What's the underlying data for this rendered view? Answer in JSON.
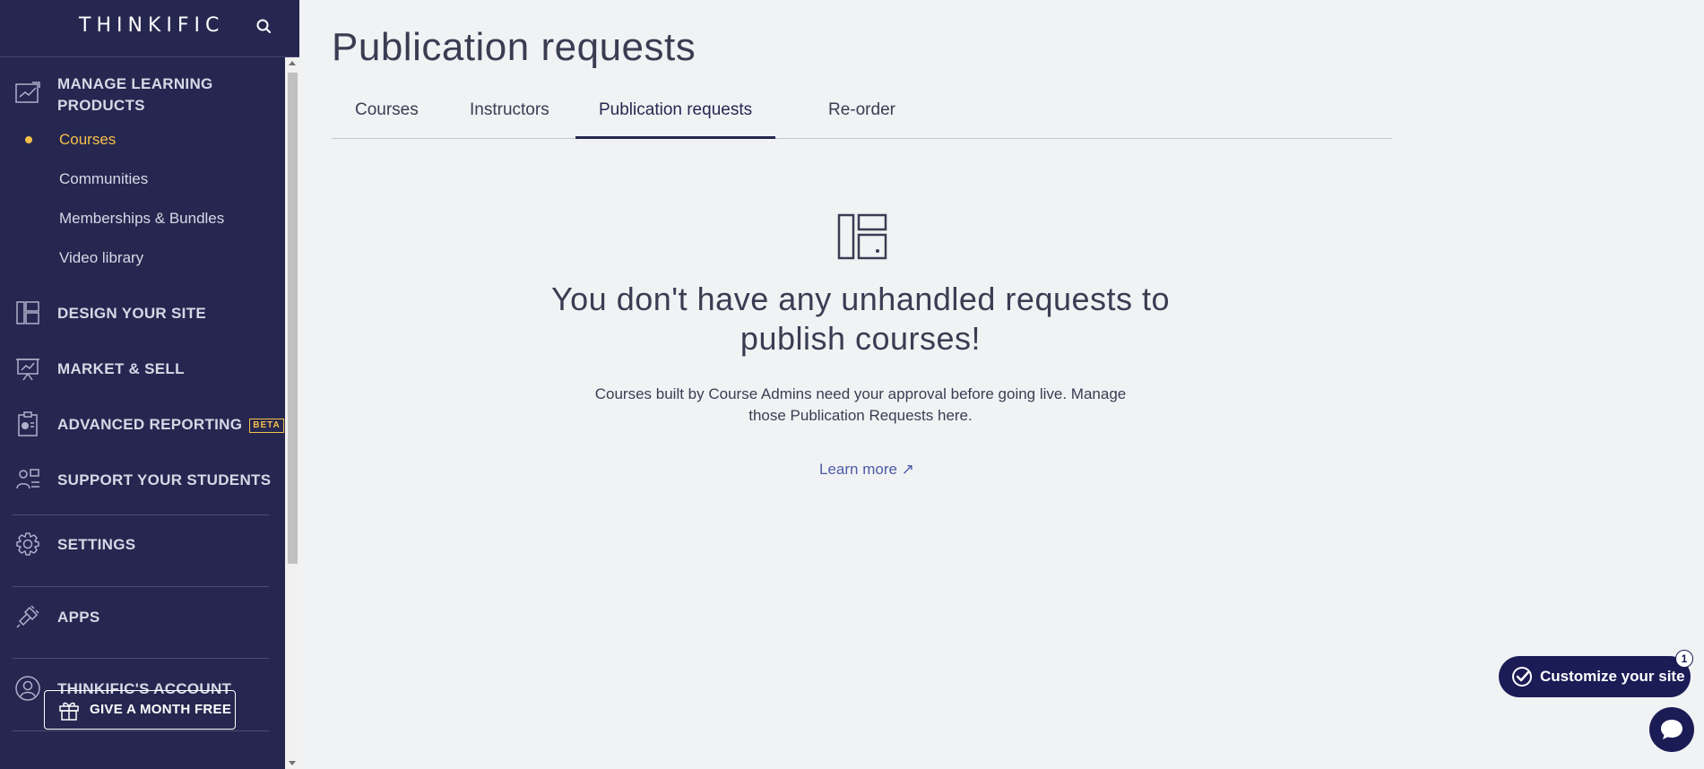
{
  "sidebar": {
    "logo": "THINKIFIC",
    "sections": {
      "manage": "MANAGE LEARNING PRODUCTS",
      "design": "DESIGN YOUR SITE",
      "market": "MARKET & SELL",
      "reporting": "ADVANCED REPORTING",
      "reporting_badge": "BETA",
      "support": "SUPPORT YOUR STUDENTS",
      "settings": "SETTINGS",
      "apps": "APPS",
      "account": "THINKIFIC'S ACCOUNT"
    },
    "manage_items": [
      "Courses",
      "Communities",
      "Memberships & Bundles",
      "Video library"
    ],
    "gift_button": "GIVE A MONTH FREE"
  },
  "main": {
    "title": "Publication requests",
    "tabs": [
      "Courses",
      "Instructors",
      "Publication requests",
      "Re-order"
    ],
    "active_tab": "Publication requests",
    "empty_title": "You don't have any unhandled requests to publish courses!",
    "empty_desc": "Courses built by Course Admins need your approval before going live. Manage those Publication Requests here.",
    "learn_more": "Learn more ↗"
  },
  "widgets": {
    "customize_label": "Customize your site",
    "customize_badge": "1"
  },
  "colors": {
    "sidebar_bg": "#262750",
    "accent": "#f6c04b",
    "link": "#4e5ba6",
    "cta_bg": "#1b1b56"
  }
}
